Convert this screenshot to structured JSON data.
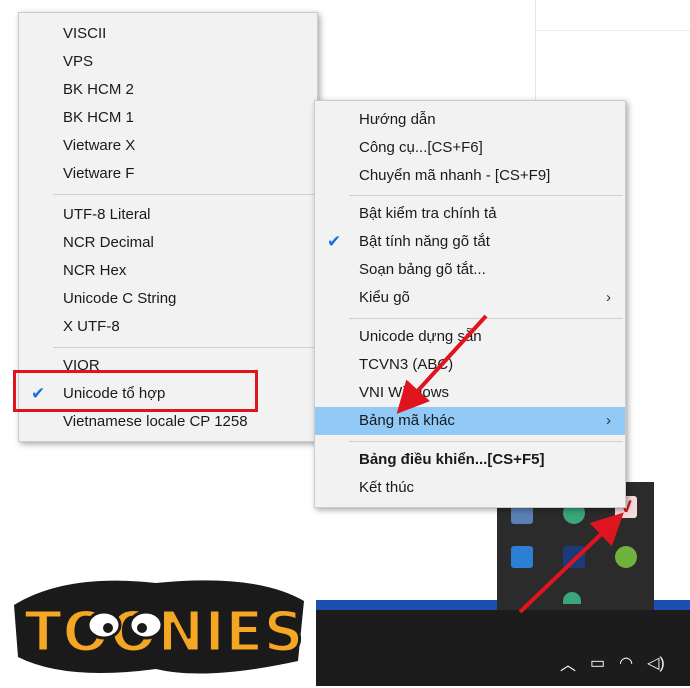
{
  "left_menu": {
    "group1": [
      "VISCII",
      "VPS",
      "BK HCM 2",
      "BK HCM 1",
      "Vietware X",
      "Vietware F"
    ],
    "group2": [
      "UTF-8 Literal",
      "NCR Decimal",
      "NCR Hex",
      "Unicode C String",
      "X UTF-8"
    ],
    "group3": [
      "VIQR",
      "Unicode tổ hợp",
      "Vietnamese locale CP 1258"
    ]
  },
  "right_menu": {
    "group1": [
      "Hướng dẫn",
      "Công cụ...[CS+F6]",
      "Chuyển mã nhanh - [CS+F9]"
    ],
    "group2": [
      "Bật kiểm tra chính tả",
      "Bật tính năng gõ tắt",
      "Soạn bảng gõ tắt...",
      "Kiểu gõ"
    ],
    "group3": [
      "Unicode dựng sẵn",
      "TCVN3 (ABC)",
      "VNI Windows",
      "Bảng mã khác"
    ],
    "group4": [
      "Bảng điều khiển...[CS+F5]",
      "Kết thúc"
    ]
  },
  "check_glyph": "✔",
  "submenu_arrow": "›",
  "logo": {
    "text": "TOONIES"
  },
  "colors": {
    "highlight": "#91c9f7",
    "annotation_red": "#e0141e",
    "taskbar": "#1c1c1c",
    "menu_bg": "#f2f2f2"
  },
  "icons": [
    "vietkey-tray-icon",
    "chevron-up-icon",
    "battery-icon",
    "wifi-icon",
    "volume-icon"
  ]
}
